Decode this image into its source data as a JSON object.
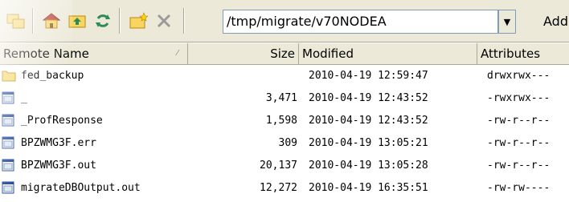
{
  "toolbar": {
    "path_value": "/tmp/migrate/v70NODEA",
    "add_label": "Add",
    "icons": [
      "folder-sync-icon",
      "home-folder-icon",
      "parent-folder-icon",
      "refresh-icon",
      "new-folder-icon",
      "delete-icon"
    ]
  },
  "columns": {
    "name": "Remote Name",
    "size": "Size",
    "modified": "Modified",
    "attributes": "Attributes"
  },
  "rows": [
    {
      "type": "folder",
      "name": "fed_backup",
      "size": "",
      "modified": "2010-04-19 12:59:47",
      "attributes": "drwxrwx---"
    },
    {
      "type": "file",
      "name": "_",
      "size": "3,471",
      "modified": "2010-04-19 12:43:52",
      "attributes": "-rwxrwx---"
    },
    {
      "type": "file",
      "name": "_ProfResponse",
      "size": "1,598",
      "modified": "2010-04-19 12:43:52",
      "attributes": "-rw-r--r--"
    },
    {
      "type": "file",
      "name": "BPZWMG3F.err",
      "size": "309",
      "modified": "2010-04-19 13:05:21",
      "attributes": "-rw-r--r--"
    },
    {
      "type": "file",
      "name": "BPZWMG3F.out",
      "size": "20,137",
      "modified": "2010-04-19 13:05:28",
      "attributes": "-rw-r--r--"
    },
    {
      "type": "file",
      "name": "migrateDBOutput.out",
      "size": "12,272",
      "modified": "2010-04-19 16:35:51",
      "attributes": "-rw-rw----"
    }
  ]
}
